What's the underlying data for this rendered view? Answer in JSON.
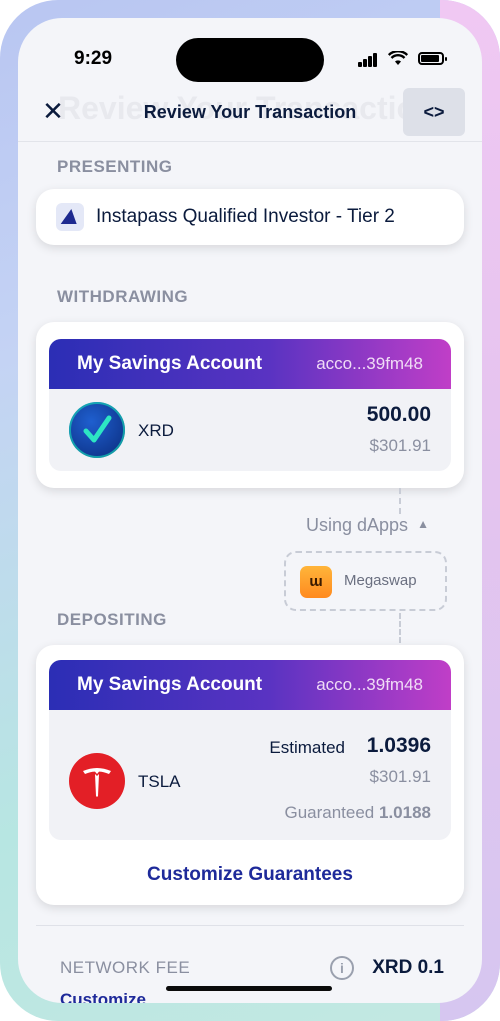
{
  "status_bar": {
    "time": "9:29"
  },
  "header": {
    "ghost_title": "Review Your Transaction",
    "title": "Review Your Transaction",
    "close_glyph": "✕",
    "code_glyph": "<>"
  },
  "presenting": {
    "label": "PRESENTING",
    "badge": "Instapass Qualified Investor - Tier 2",
    "icon": "instapass-logo-icon"
  },
  "withdrawing": {
    "label": "WITHDRAWING",
    "account_name": "My Savings Account",
    "account_address": "acco...39fm48",
    "token": {
      "symbol": "XRD",
      "amount": "500.00",
      "usd": "$301.91",
      "icon": "xrd-token-icon"
    }
  },
  "dapps": {
    "toggle_label": "Using dApps",
    "toggle_icon": "chevron-up-icon",
    "items": [
      {
        "name": "Megaswap",
        "icon": "megaswap-logo-icon",
        "glyph": "ɯ"
      }
    ]
  },
  "depositing": {
    "label": "DEPOSITING",
    "account_name": "My Savings Account",
    "account_address": "acco...39fm48",
    "token": {
      "symbol": "TSLA",
      "estimated_label": "Estimated",
      "amount": "1.0396",
      "usd": "$301.91",
      "guaranteed_label": "Guaranteed",
      "guaranteed_value": "1.0188",
      "icon": "tesla-logo-icon"
    },
    "customize_link": "Customize Guarantees"
  },
  "network_fee": {
    "label": "NETWORK FEE",
    "value": "XRD 0.1",
    "customize": "Customize"
  },
  "colors": {
    "accent": "#1e2a9a",
    "gradient_start": "#2b2eb5",
    "gradient_end": "#c03ec7",
    "text_primary": "#0b1b3d",
    "text_secondary": "#8a8fa0"
  }
}
